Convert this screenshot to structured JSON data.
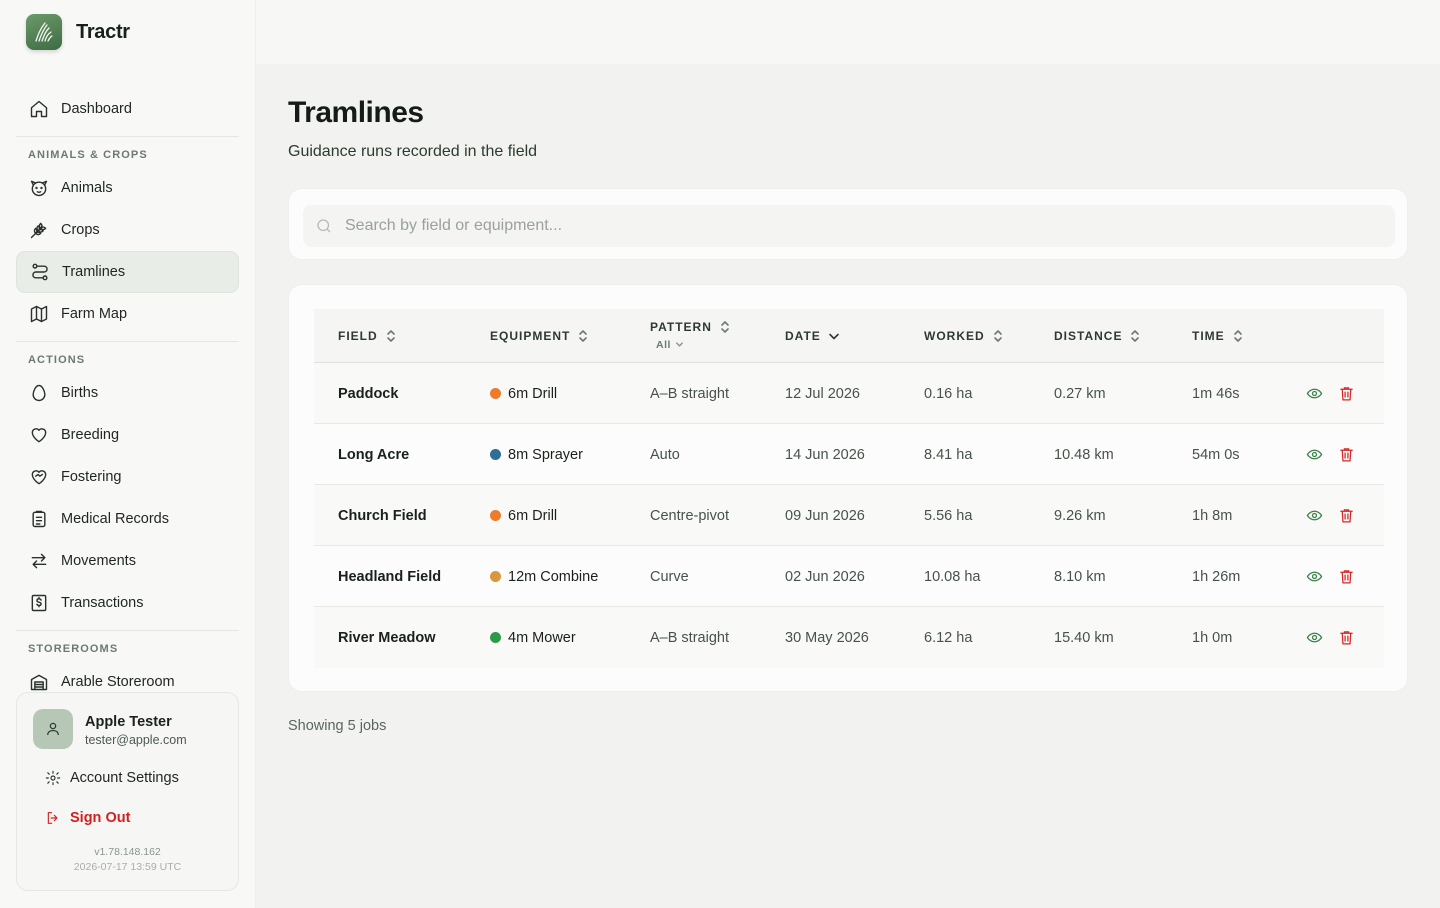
{
  "brand": {
    "name": "Tractr"
  },
  "nav": {
    "dashboard": "Dashboard",
    "section_animals_crops": "ANIMALS & CROPS",
    "animals": "Animals",
    "crops": "Crops",
    "tramlines": "Tramlines",
    "farm_map": "Farm Map",
    "section_actions": "ACTIONS",
    "births": "Births",
    "breeding": "Breeding",
    "fostering": "Fostering",
    "medical_records": "Medical Records",
    "movements": "Movements",
    "transactions": "Transactions",
    "section_storerooms": "STOREROOMS",
    "arable_storeroom": "Arable Storeroom",
    "active_item": "Tramlines"
  },
  "user": {
    "name": "Apple Tester",
    "email": "tester@apple.com",
    "account_settings": "Account Settings",
    "sign_out": "Sign Out",
    "version": "v1.78.148.162",
    "build_time": "2026-07-17 13:59 UTC"
  },
  "page": {
    "title": "Tramlines",
    "subtitle": "Guidance runs recorded in the field"
  },
  "search": {
    "placeholder": "Search by field or equipment..."
  },
  "table": {
    "headers": {
      "field": "FIELD",
      "equipment": "EQUIPMENT",
      "pattern": "PATTERN",
      "pattern_filter": "All",
      "date": "DATE",
      "worked": "WORKED",
      "distance": "DISTANCE",
      "time": "TIME"
    },
    "sort": {
      "column": "date",
      "direction": "descending"
    },
    "rows": [
      {
        "field": "Paddock",
        "equipment": "6m Drill",
        "equipment_color": "#ef7a2a",
        "pattern": "A–B straight",
        "date": "12 Jul 2026",
        "worked": "0.16 ha",
        "distance": "0.27 km",
        "time": "1m 46s"
      },
      {
        "field": "Long Acre",
        "equipment": "8m Sprayer",
        "equipment_color": "#2d6f95",
        "pattern": "Auto",
        "date": "14 Jun 2026",
        "worked": "8.41 ha",
        "distance": "10.48 km",
        "time": "54m 0s"
      },
      {
        "field": "Church Field",
        "equipment": "6m Drill",
        "equipment_color": "#ef7a2a",
        "pattern": "Centre-pivot",
        "date": "09 Jun 2026",
        "worked": "5.56 ha",
        "distance": "9.26 km",
        "time": "1h 8m"
      },
      {
        "field": "Headland Field",
        "equipment": "12m Combine",
        "equipment_color": "#d6973e",
        "pattern": "Curve",
        "date": "02 Jun 2026",
        "worked": "10.08 ha",
        "distance": "8.10 km",
        "time": "1h 26m"
      },
      {
        "field": "River Meadow",
        "equipment": "4m Mower",
        "equipment_color": "#2b9a4a",
        "pattern": "A–B straight",
        "date": "30 May 2026",
        "worked": "6.12 ha",
        "distance": "15.40 km",
        "time": "1h 0m"
      }
    ]
  },
  "footer": {
    "count_text": "Showing 5 jobs"
  },
  "colors": {
    "accent": "#3e7f4a",
    "danger": "#d42626",
    "brand_green": "#4f7d52"
  }
}
